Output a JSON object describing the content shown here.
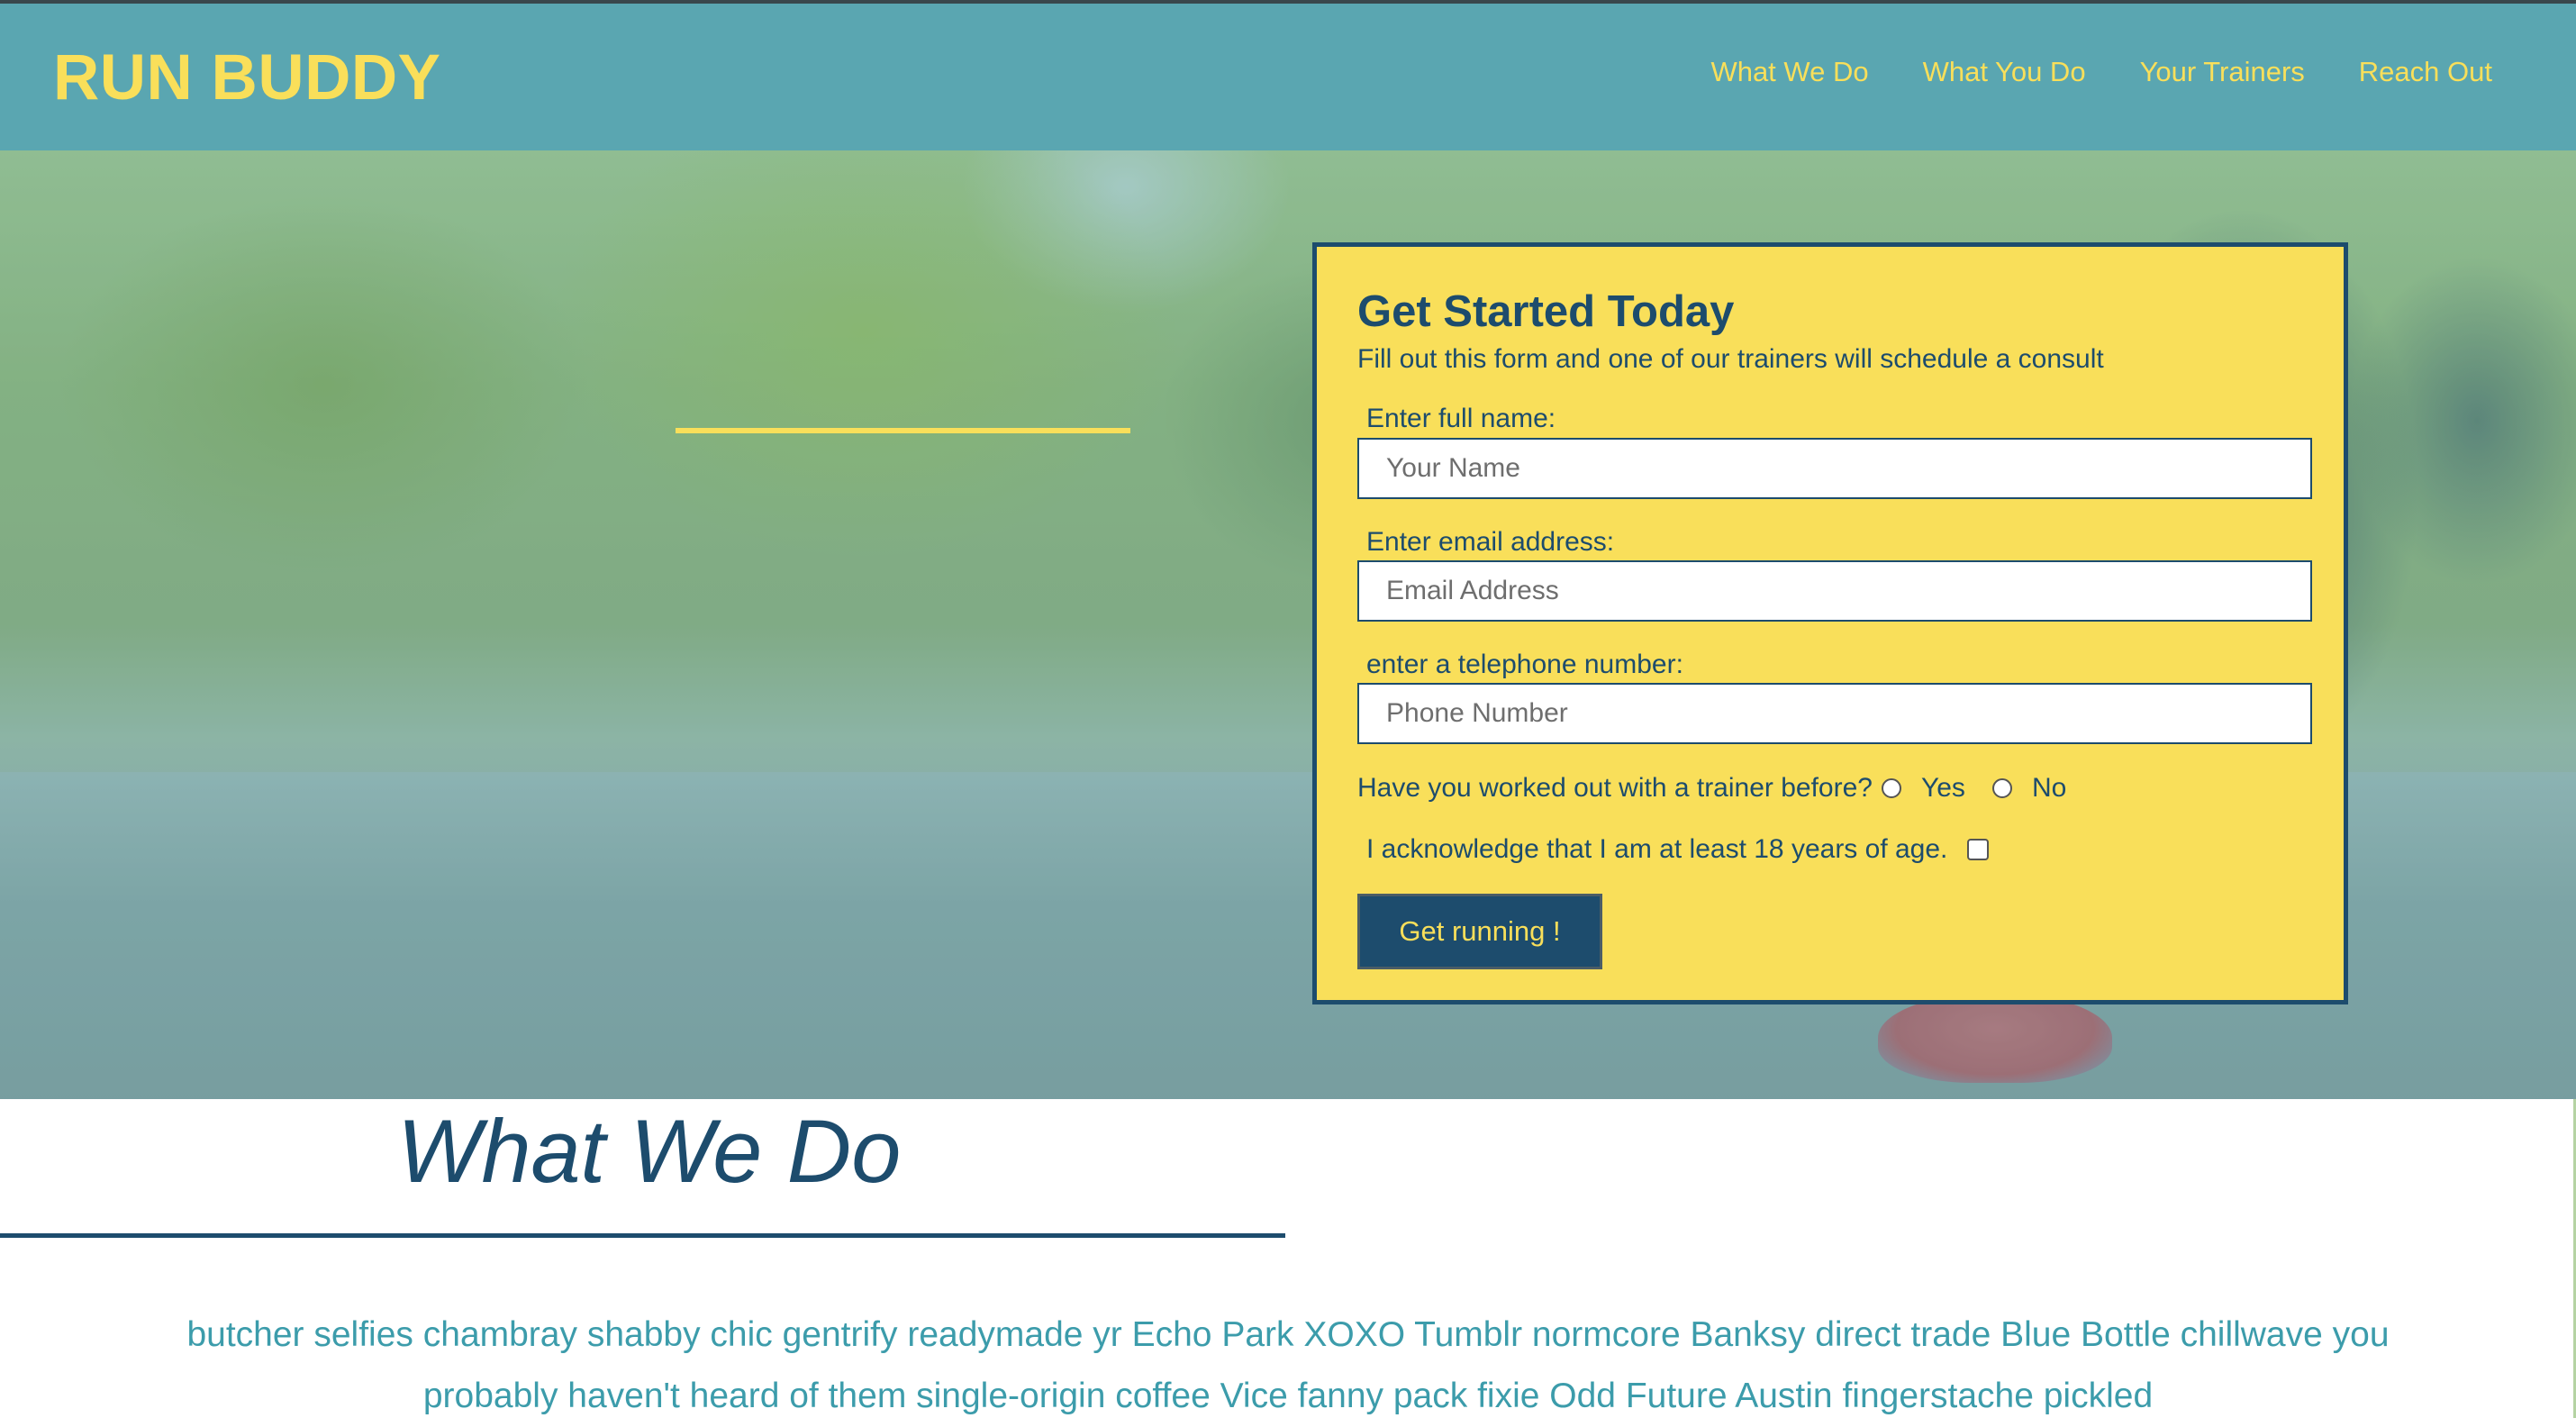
{
  "header": {
    "logo": "RUN BUDDY",
    "nav": [
      "What We Do",
      "What You Do",
      "Your Trainers",
      "Reach Out"
    ]
  },
  "form": {
    "title": "Get Started Today",
    "subtitle": "Fill out this form and one of our trainers will schedule a consult",
    "name_label": "Enter full name:",
    "name_placeholder": "Your Name",
    "email_label": "Enter email address:",
    "email_placeholder": "Email Address",
    "phone_label": "enter a telephone number:",
    "phone_placeholder": "Phone Number",
    "trainer_question": "Have you worked out with a trainer before?",
    "yes_label": "Yes",
    "no_label": "No",
    "acknowledge": "I acknowledge that I am at least 18 years of age.",
    "submit_label": "Get running !"
  },
  "section": {
    "title": "What We Do",
    "body": "butcher selfies chambray shabby chic gentrify readymade yr Echo Park XOXO Tumblr normcore Banksy direct trade Blue Bottle chillwave you probably haven't heard of them single-origin coffee Vice fanny pack fixie Odd Future Austin fingerstache pickled"
  },
  "colors": {
    "header_bg": "#5aa6b1",
    "brand_yellow": "#f9df5a",
    "navy": "#1d4c6d",
    "teal_text": "#3c9cab"
  }
}
